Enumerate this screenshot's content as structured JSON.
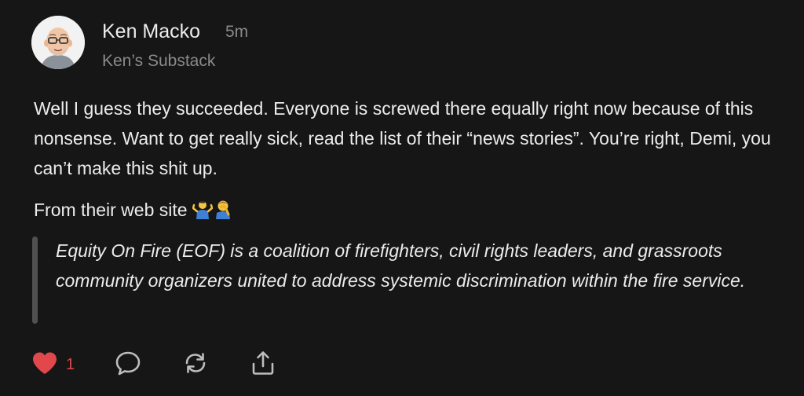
{
  "post": {
    "author": {
      "name": "Ken Macko",
      "publication": "Ken’s Substack",
      "avatar": "cartoon-man-avatar"
    },
    "timestamp": "5m",
    "paragraphs": [
      "Well I guess they succeeded. Everyone is screwed there equally right now because of this nonsense. Want to get really sick, read the list of their “news stories”. You’re right, Demi, you can’t make this shit up.",
      "From their web site"
    ],
    "emojis": [
      "person-shrugging-emoji",
      "man-facepalming-emoji"
    ],
    "quote": "Equity On Fire (EOF) is a coalition of firefighters, civil rights leaders, and grassroots community organizers united to address systemic discrimination within the fire service."
  },
  "actions": {
    "like_count": "1",
    "icons": [
      "heart-icon",
      "comment-icon",
      "restack-icon",
      "share-icon"
    ]
  },
  "colors": {
    "background": "#161616",
    "text": "#ececec",
    "muted": "#8a8a8a",
    "like": "#e0484c",
    "quote_bar": "#505050"
  }
}
